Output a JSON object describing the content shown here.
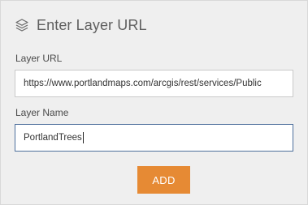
{
  "dialog": {
    "title": "Enter Layer URL",
    "title_icon": "layers-icon"
  },
  "layer_url": {
    "label": "Layer URL",
    "value": "https://www.portlandmaps.com/arcgis/rest/services/Public"
  },
  "layer_name": {
    "label": "Layer Name",
    "value": "PortlandTrees"
  },
  "actions": {
    "add_label": "ADD"
  },
  "colors": {
    "panel_background": "#efefef",
    "accent": "#e68a34",
    "focused_border": "#4e6f9c"
  }
}
